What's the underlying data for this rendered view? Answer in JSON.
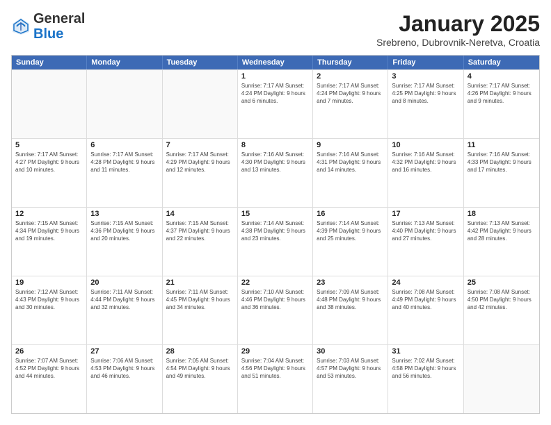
{
  "header": {
    "logo": {
      "general": "General",
      "blue": "Blue"
    },
    "title": "January 2025",
    "location": "Srebreno, Dubrovnik-Neretva, Croatia"
  },
  "days_of_week": [
    "Sunday",
    "Monday",
    "Tuesday",
    "Wednesday",
    "Thursday",
    "Friday",
    "Saturday"
  ],
  "rows": [
    [
      {
        "day": "",
        "info": ""
      },
      {
        "day": "",
        "info": ""
      },
      {
        "day": "",
        "info": ""
      },
      {
        "day": "1",
        "info": "Sunrise: 7:17 AM\nSunset: 4:24 PM\nDaylight: 9 hours\nand 6 minutes."
      },
      {
        "day": "2",
        "info": "Sunrise: 7:17 AM\nSunset: 4:24 PM\nDaylight: 9 hours\nand 7 minutes."
      },
      {
        "day": "3",
        "info": "Sunrise: 7:17 AM\nSunset: 4:25 PM\nDaylight: 9 hours\nand 8 minutes."
      },
      {
        "day": "4",
        "info": "Sunrise: 7:17 AM\nSunset: 4:26 PM\nDaylight: 9 hours\nand 9 minutes."
      }
    ],
    [
      {
        "day": "5",
        "info": "Sunrise: 7:17 AM\nSunset: 4:27 PM\nDaylight: 9 hours\nand 10 minutes."
      },
      {
        "day": "6",
        "info": "Sunrise: 7:17 AM\nSunset: 4:28 PM\nDaylight: 9 hours\nand 11 minutes."
      },
      {
        "day": "7",
        "info": "Sunrise: 7:17 AM\nSunset: 4:29 PM\nDaylight: 9 hours\nand 12 minutes."
      },
      {
        "day": "8",
        "info": "Sunrise: 7:16 AM\nSunset: 4:30 PM\nDaylight: 9 hours\nand 13 minutes."
      },
      {
        "day": "9",
        "info": "Sunrise: 7:16 AM\nSunset: 4:31 PM\nDaylight: 9 hours\nand 14 minutes."
      },
      {
        "day": "10",
        "info": "Sunrise: 7:16 AM\nSunset: 4:32 PM\nDaylight: 9 hours\nand 16 minutes."
      },
      {
        "day": "11",
        "info": "Sunrise: 7:16 AM\nSunset: 4:33 PM\nDaylight: 9 hours\nand 17 minutes."
      }
    ],
    [
      {
        "day": "12",
        "info": "Sunrise: 7:15 AM\nSunset: 4:34 PM\nDaylight: 9 hours\nand 19 minutes."
      },
      {
        "day": "13",
        "info": "Sunrise: 7:15 AM\nSunset: 4:36 PM\nDaylight: 9 hours\nand 20 minutes."
      },
      {
        "day": "14",
        "info": "Sunrise: 7:15 AM\nSunset: 4:37 PM\nDaylight: 9 hours\nand 22 minutes."
      },
      {
        "day": "15",
        "info": "Sunrise: 7:14 AM\nSunset: 4:38 PM\nDaylight: 9 hours\nand 23 minutes."
      },
      {
        "day": "16",
        "info": "Sunrise: 7:14 AM\nSunset: 4:39 PM\nDaylight: 9 hours\nand 25 minutes."
      },
      {
        "day": "17",
        "info": "Sunrise: 7:13 AM\nSunset: 4:40 PM\nDaylight: 9 hours\nand 27 minutes."
      },
      {
        "day": "18",
        "info": "Sunrise: 7:13 AM\nSunset: 4:42 PM\nDaylight: 9 hours\nand 28 minutes."
      }
    ],
    [
      {
        "day": "19",
        "info": "Sunrise: 7:12 AM\nSunset: 4:43 PM\nDaylight: 9 hours\nand 30 minutes."
      },
      {
        "day": "20",
        "info": "Sunrise: 7:11 AM\nSunset: 4:44 PM\nDaylight: 9 hours\nand 32 minutes."
      },
      {
        "day": "21",
        "info": "Sunrise: 7:11 AM\nSunset: 4:45 PM\nDaylight: 9 hours\nand 34 minutes."
      },
      {
        "day": "22",
        "info": "Sunrise: 7:10 AM\nSunset: 4:46 PM\nDaylight: 9 hours\nand 36 minutes."
      },
      {
        "day": "23",
        "info": "Sunrise: 7:09 AM\nSunset: 4:48 PM\nDaylight: 9 hours\nand 38 minutes."
      },
      {
        "day": "24",
        "info": "Sunrise: 7:08 AM\nSunset: 4:49 PM\nDaylight: 9 hours\nand 40 minutes."
      },
      {
        "day": "25",
        "info": "Sunrise: 7:08 AM\nSunset: 4:50 PM\nDaylight: 9 hours\nand 42 minutes."
      }
    ],
    [
      {
        "day": "26",
        "info": "Sunrise: 7:07 AM\nSunset: 4:52 PM\nDaylight: 9 hours\nand 44 minutes."
      },
      {
        "day": "27",
        "info": "Sunrise: 7:06 AM\nSunset: 4:53 PM\nDaylight: 9 hours\nand 46 minutes."
      },
      {
        "day": "28",
        "info": "Sunrise: 7:05 AM\nSunset: 4:54 PM\nDaylight: 9 hours\nand 49 minutes."
      },
      {
        "day": "29",
        "info": "Sunrise: 7:04 AM\nSunset: 4:56 PM\nDaylight: 9 hours\nand 51 minutes."
      },
      {
        "day": "30",
        "info": "Sunrise: 7:03 AM\nSunset: 4:57 PM\nDaylight: 9 hours\nand 53 minutes."
      },
      {
        "day": "31",
        "info": "Sunrise: 7:02 AM\nSunset: 4:58 PM\nDaylight: 9 hours\nand 56 minutes."
      },
      {
        "day": "",
        "info": ""
      }
    ]
  ]
}
